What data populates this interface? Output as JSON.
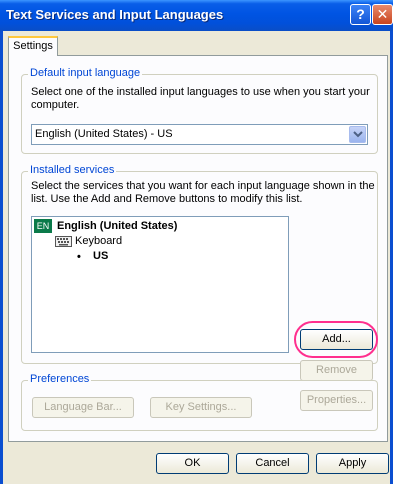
{
  "window": {
    "title": "Text Services and Input Languages",
    "help_glyph": "?",
    "close_glyph": "✕"
  },
  "tabs": [
    {
      "label": "Settings",
      "selected": true
    }
  ],
  "default_input_language": {
    "label": "Default input language",
    "description": "Select one of the installed input languages to use when you start your computer.",
    "selected_value": "English (United States) - US"
  },
  "installed_services": {
    "label": "Installed services",
    "description": "Select the services that you want for each input language shown in the list. Use the Add and Remove buttons to modify this list.",
    "tree": {
      "language_badge": "EN",
      "language": "English (United States)",
      "category_icon": "keyboard-icon",
      "category": "Keyboard",
      "bullet": "•",
      "layout": "US"
    },
    "buttons": {
      "add": "Add...",
      "remove": "Remove",
      "properties": "Properties..."
    },
    "disabled": {
      "remove": true,
      "properties": true
    },
    "annotation_color": "#ff2f8e"
  },
  "preferences": {
    "label": "Preferences",
    "buttons": {
      "language_bar": "Language Bar...",
      "key_settings": "Key Settings..."
    },
    "disabled": {
      "language_bar": true,
      "key_settings": true
    }
  },
  "dialog_buttons": {
    "ok": "OK",
    "cancel": "Cancel",
    "apply": "Apply"
  },
  "colors": {
    "title_bar": "#0054e3",
    "face": "#ece9d8",
    "group_label": "#0046d5",
    "tab_accent": "#ffc83c"
  }
}
